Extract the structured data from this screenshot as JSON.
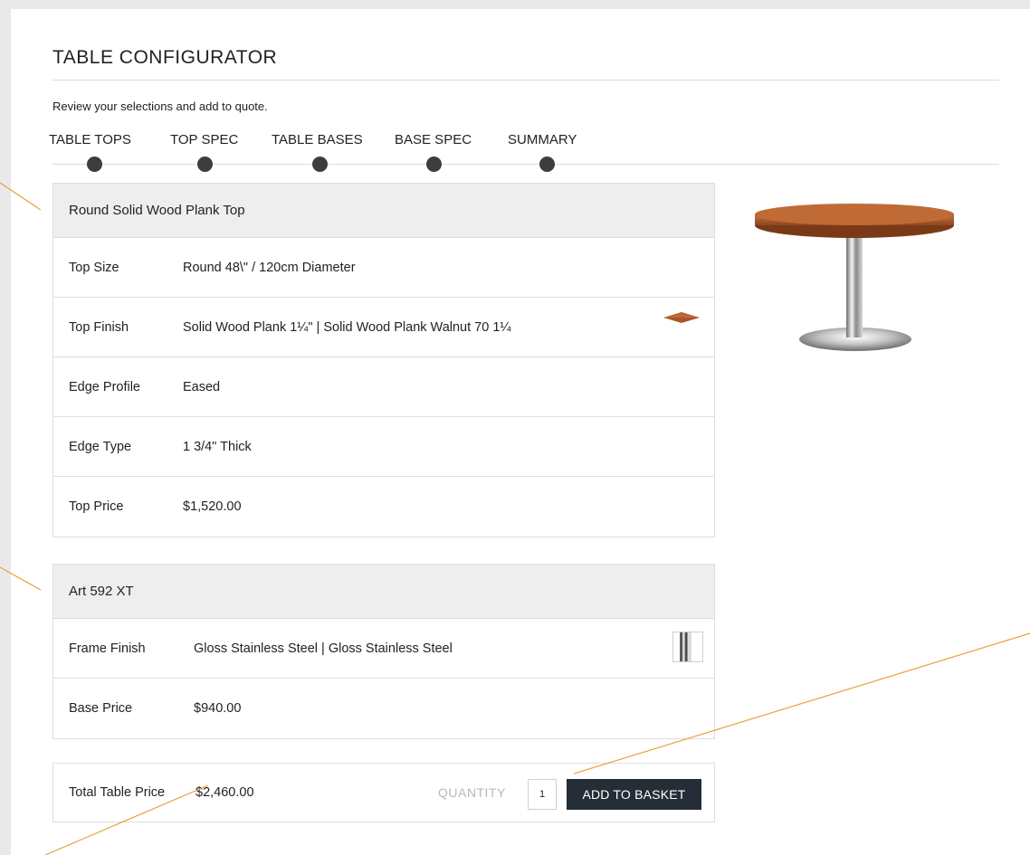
{
  "header": {
    "title": "TABLE CONFIGURATOR",
    "subtitle": "Review your selections and add to quote."
  },
  "steps": [
    {
      "label": "TABLE TOPS"
    },
    {
      "label": "TOP SPEC"
    },
    {
      "label": "TABLE BASES"
    },
    {
      "label": "BASE SPEC"
    },
    {
      "label": "SUMMARY"
    }
  ],
  "top_panel": {
    "title": "Round Solid Wood Plank Top",
    "rows": [
      {
        "label": "Top Size",
        "value": "Round 48\\\" / 120cm Diameter"
      },
      {
        "label": "Top Finish",
        "value": "Solid Wood Plank 1¼\" | Solid Wood Plank Walnut 70 1¼"
      },
      {
        "label": "Edge Profile",
        "value": "Eased"
      },
      {
        "label": "Edge Type",
        "value": "1 3/4\" Thick"
      },
      {
        "label": "Top Price",
        "value": "$1,520.00"
      }
    ]
  },
  "base_panel": {
    "title": "Art 592 XT",
    "rows": [
      {
        "label": "Frame Finish",
        "value": "Gloss Stainless Steel | Gloss Stainless Steel"
      },
      {
        "label": "Base Price",
        "value": "$940.00"
      }
    ]
  },
  "total": {
    "label": "Total Table Price",
    "value": "$2,460.00",
    "quantity_label": "QUANTITY",
    "quantity_value": "1",
    "add_button": "ADD TO BASKET"
  },
  "colors": {
    "accent_button": "#252d36",
    "callout_line": "#e8a23a",
    "wood": "#a8552a",
    "step_dot": "#3d3d3d"
  },
  "icons": {
    "wood_swatch": "wood-finish-swatch",
    "steel_swatch": "stainless-steel-swatch",
    "product_image": "round-table-image"
  }
}
